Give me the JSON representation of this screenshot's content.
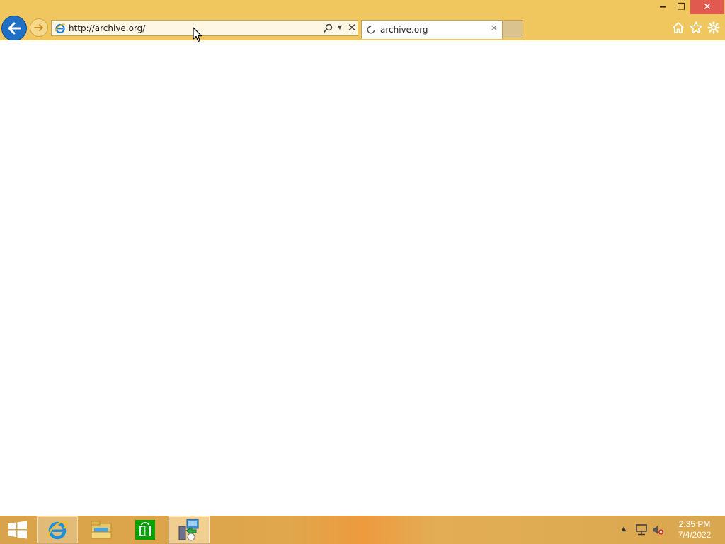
{
  "browser": {
    "address_url": "http://archive.org/",
    "tab_title": "archive.org",
    "accent_color": "#f0c75e",
    "nav_color": "#1f6fc4"
  },
  "icons": {
    "window": [
      "minimize-icon",
      "restore-icon",
      "close-icon"
    ],
    "nav": [
      "back-arrow-icon",
      "forward-arrow-icon"
    ],
    "address": [
      "ie-logo-icon",
      "search-icon",
      "chevron-down-icon",
      "stop-icon"
    ],
    "tab": [
      "loading-spinner-icon",
      "tab-close-icon"
    ],
    "command": [
      "home-icon",
      "star-icon",
      "gear-icon"
    ],
    "taskbar": [
      "windows-logo-icon",
      "internet-explorer-icon",
      "file-explorer-icon",
      "store-icon",
      "remote-desktop-icon"
    ],
    "tray": [
      "chevron-up-icon",
      "network-icon",
      "volume-muted-icon"
    ]
  },
  "taskbar": {
    "clock_time": "2:35 PM",
    "clock_date": "7/4/2022"
  }
}
